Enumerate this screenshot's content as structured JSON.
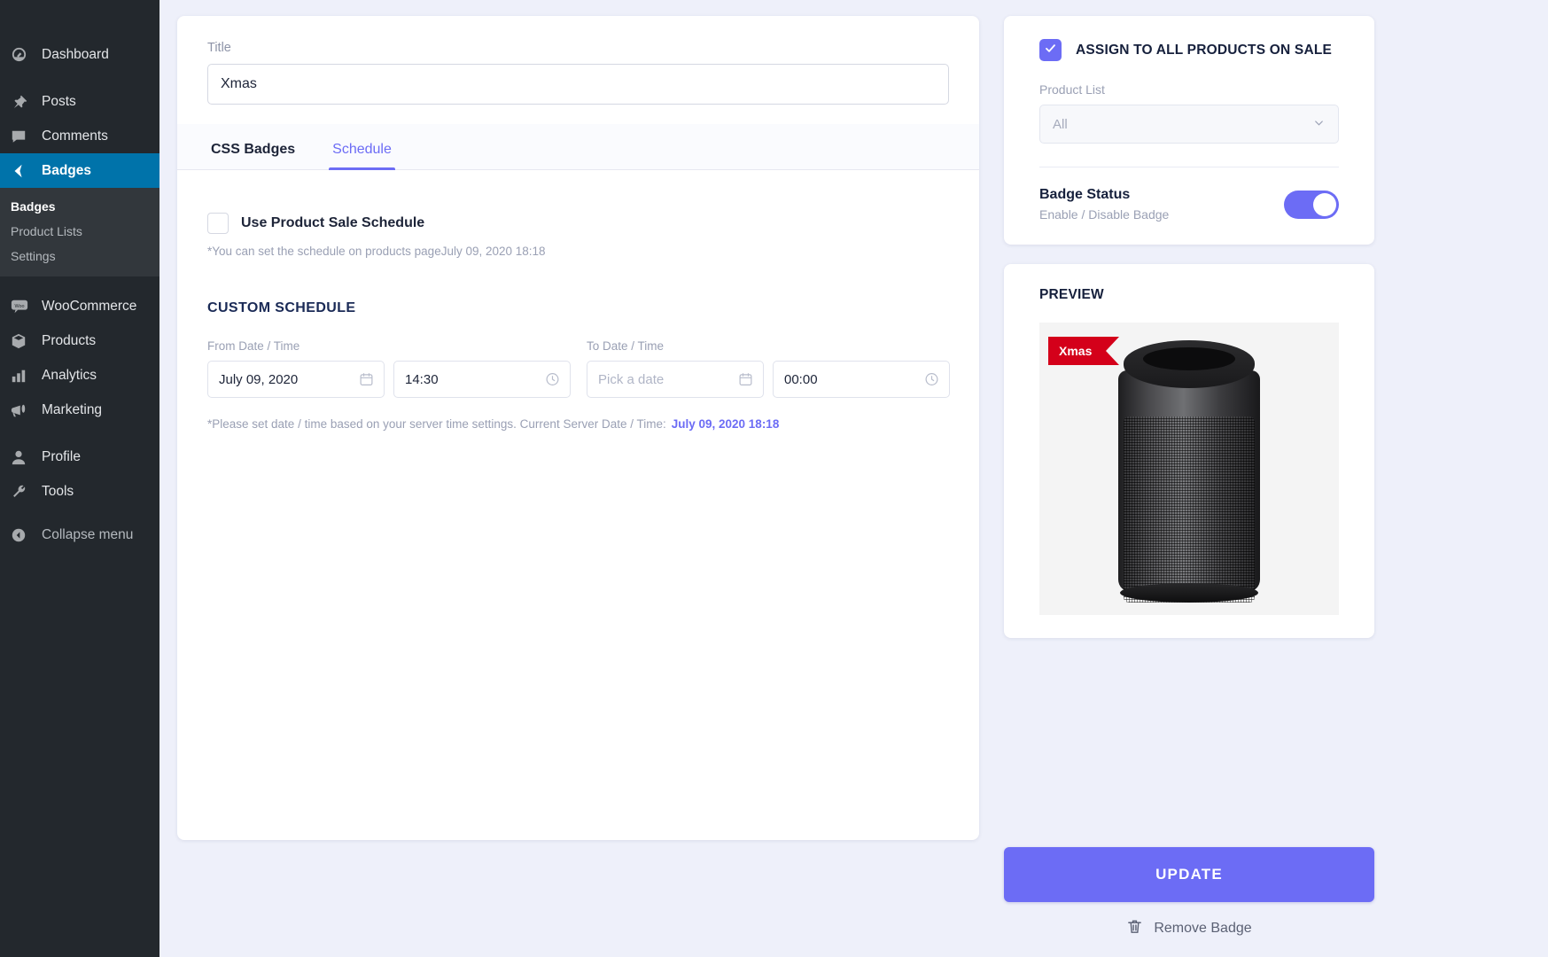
{
  "sidebar": {
    "items": [
      {
        "label": "Dashboard",
        "icon": "dashboard-icon",
        "active": false
      },
      {
        "label": "Posts",
        "icon": "pin-icon",
        "active": false
      },
      {
        "label": "Comments",
        "icon": "comment-icon",
        "active": false
      },
      {
        "label": "Badges",
        "icon": "badge-icon",
        "active": true
      },
      {
        "label": "WooCommerce",
        "icon": "woo-icon",
        "active": false
      },
      {
        "label": "Products",
        "icon": "box-icon",
        "active": false
      },
      {
        "label": "Analytics",
        "icon": "bar-chart-icon",
        "active": false
      },
      {
        "label": "Marketing",
        "icon": "megaphone-icon",
        "active": false
      },
      {
        "label": "Profile",
        "icon": "user-icon",
        "active": false
      },
      {
        "label": "Tools",
        "icon": "wrench-icon",
        "active": false
      }
    ],
    "submenu": [
      {
        "label": "Badges",
        "current": true
      },
      {
        "label": "Product Lists",
        "current": false
      },
      {
        "label": "Settings",
        "current": false
      }
    ],
    "collapse_label": "Collapse menu"
  },
  "main": {
    "title_field": {
      "label": "Title",
      "value": "Xmas",
      "placeholder": "Title"
    },
    "tabs": [
      {
        "label": "CSS Badges",
        "active": false
      },
      {
        "label": "Schedule",
        "active": true
      }
    ],
    "use_product_sale_schedule": {
      "label": "Use Product Sale Schedule",
      "checked": false,
      "hint": "*You can set the schedule on products pageJuly 09, 2020 18:18"
    },
    "custom_schedule": {
      "heading": "CUSTOM SCHEDULE",
      "from": {
        "label": "From Date / Time",
        "date_value": "July 09, 2020",
        "date_placeholder": "Pick a date",
        "time_value": "14:30"
      },
      "to": {
        "label": "To Date / Time",
        "date_value": "",
        "date_placeholder": "Pick a date",
        "time_value": "00:00"
      },
      "note_text": "*Please set date / time based on your server time settings. Current Server Date / Time:",
      "note_server_datetime": "July 09, 2020 18:18"
    }
  },
  "right": {
    "assign": {
      "label": "ASSIGN TO ALL PRODUCTS ON SALE",
      "checked": true
    },
    "product_list": {
      "label": "Product List",
      "selected": "All"
    },
    "badge_status": {
      "title": "Badge Status",
      "subtitle": "Enable / Disable Badge",
      "enabled": true
    },
    "preview": {
      "title": "PREVIEW",
      "badge_text": "Xmas",
      "badge_color": "#d4001a"
    },
    "update_label": "UPDATE",
    "remove_label": "Remove Badge"
  },
  "colors": {
    "accent": "#6c6cf5",
    "sidebar_active": "#0073aa",
    "sidebar_bg": "#23282d",
    "page_bg": "#eef0fa",
    "badge_red": "#d4001a"
  }
}
